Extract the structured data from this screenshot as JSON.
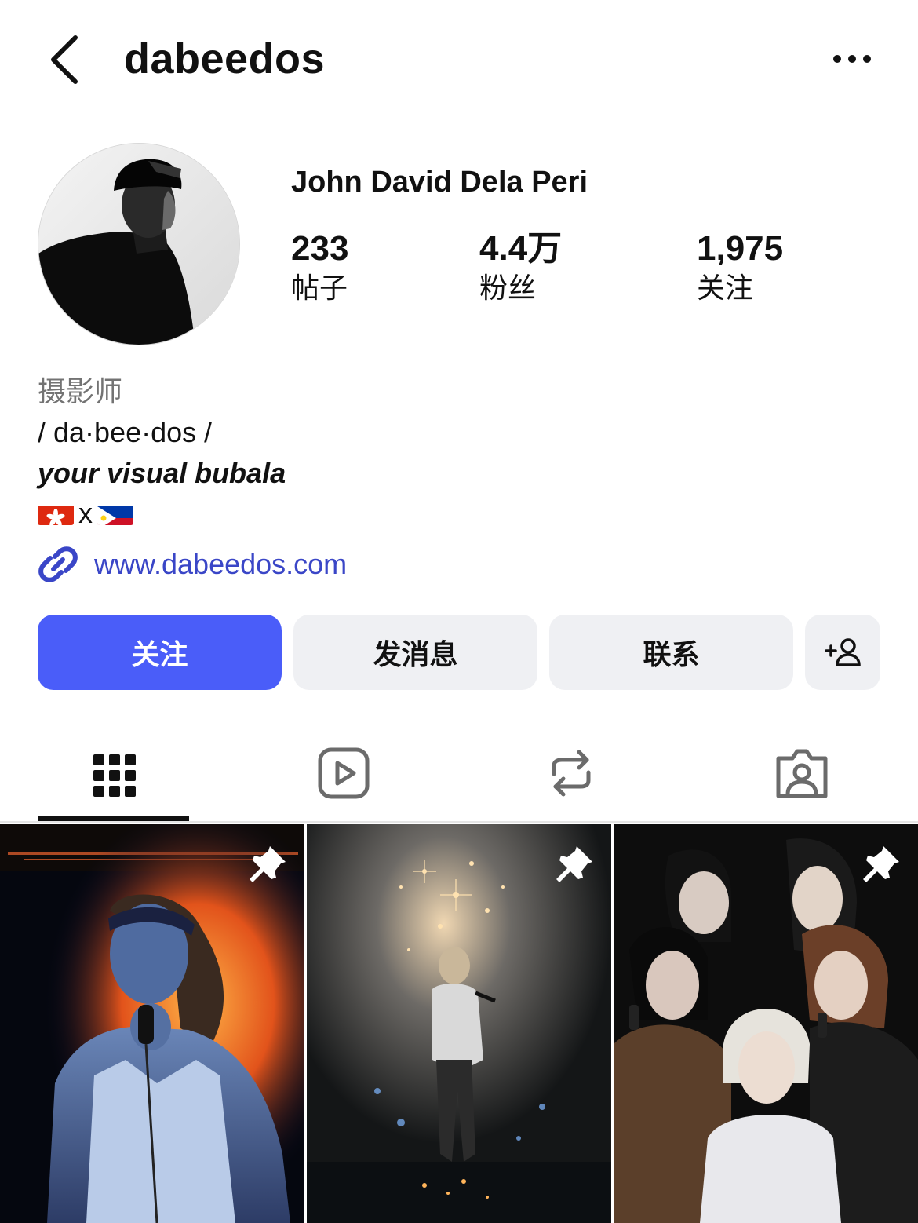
{
  "header": {
    "username": "dabeedos",
    "back_icon": "chevron-left-icon",
    "more_icon": "more-horizontal-icon"
  },
  "profile": {
    "full_name": "John David Dela Peri",
    "stats": [
      {
        "value": "233",
        "label": "帖子"
      },
      {
        "value": "4.4万",
        "label": "粉丝"
      },
      {
        "value": "1,975",
        "label": "关注"
      }
    ]
  },
  "bio": {
    "category": "摄影师",
    "line1": "/ da·bee·dos /",
    "line2": "your visual bubala",
    "line3_sep": "x",
    "flags": [
      "hong-kong-flag",
      "philippines-flag"
    ],
    "link": "www.dabeedos.com"
  },
  "actions": {
    "follow": "关注",
    "message": "发消息",
    "contact": "联系",
    "add_user_icon": "add-person-icon"
  },
  "tabs": [
    {
      "name": "grid",
      "icon": "grid-icon",
      "active": true
    },
    {
      "name": "reels",
      "icon": "reels-icon",
      "active": false
    },
    {
      "name": "reposts",
      "icon": "repost-icon",
      "active": false
    },
    {
      "name": "tagged",
      "icon": "tagged-icon",
      "active": false
    }
  ],
  "posts": [
    {
      "pinned": true,
      "subject": "singer-with-fire-light"
    },
    {
      "pinned": true,
      "subject": "performer-with-sparkles"
    },
    {
      "pinned": true,
      "subject": "group-of-four-singers"
    }
  ],
  "colors": {
    "accent": "#4a5df9",
    "link": "#3a46c7",
    "secondary_button": "#eff0f3",
    "muted_text": "#737373"
  }
}
